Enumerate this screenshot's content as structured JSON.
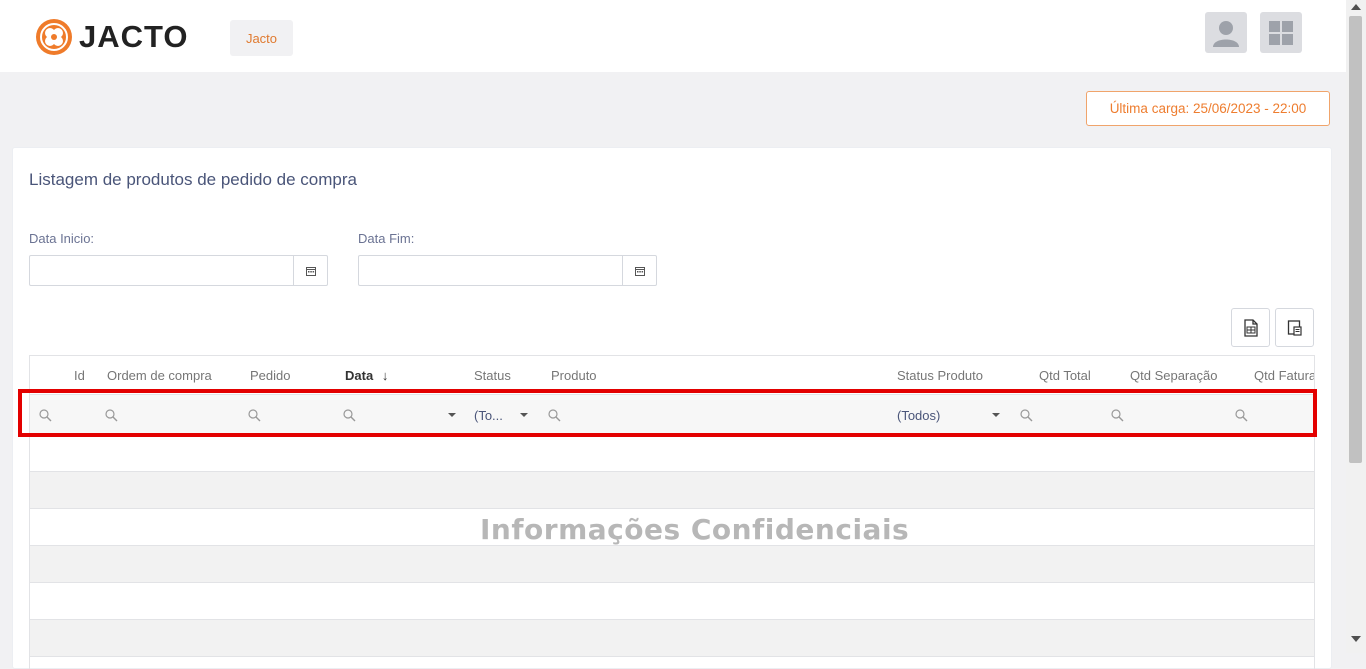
{
  "header": {
    "logo_text": "JACTO",
    "company_button": "Jacto",
    "icons": [
      "user-icon",
      "apps-grid-icon"
    ]
  },
  "last_load": "Última carga: 25/06/2023 - 22:00",
  "card": {
    "title": "Listagem de produtos de pedido de compra",
    "start_date": {
      "label": "Data Inicio:",
      "value": ""
    },
    "end_date": {
      "label": "Data Fim:",
      "value": ""
    }
  },
  "grid": {
    "columns": [
      "Id",
      "Ordem de compra",
      "Pedido",
      "Data",
      "Status",
      "Produto",
      "Status Produto",
      "Qtd Total",
      "Qtd Separação",
      "Qtd Fatura"
    ],
    "sorted_column": "Data",
    "sort_icon": "↓",
    "filters": {
      "status": "(To...",
      "status_produto": "(Todos)"
    },
    "watermark": "Informações Confidenciais"
  },
  "colors": {
    "accent": "#ee7d2f",
    "highlight": "#e30000",
    "title": "#4a5579"
  }
}
